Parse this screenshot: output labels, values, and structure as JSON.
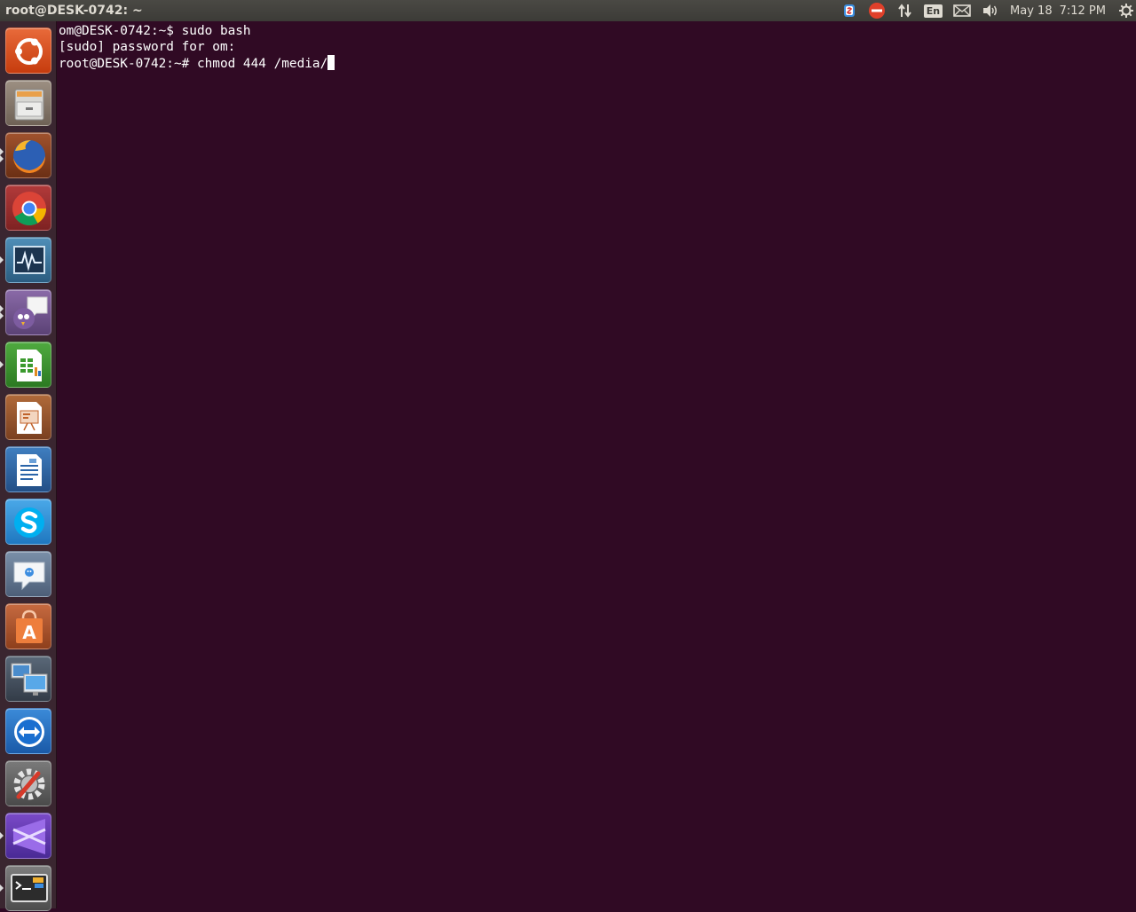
{
  "top_panel": {
    "window_title": "root@DESK-0742: ~",
    "indicators": {
      "keyboard_layout": "En",
      "date": "May 18",
      "time": "7:12 PM",
      "icons": [
        "skype-status-icon",
        "do-not-disturb-icon",
        "network-updown-icon",
        "keyboard-layout-icon",
        "mail-icon",
        "volume-icon",
        "session-gear-icon"
      ]
    }
  },
  "launcher": {
    "items": [
      {
        "name": "dash-home",
        "icon": "ubuntu-logo-icon",
        "running": false
      },
      {
        "name": "files",
        "icon": "file-cabinet-icon",
        "running": false
      },
      {
        "name": "firefox",
        "icon": "firefox-icon",
        "running": true
      },
      {
        "name": "chrome",
        "icon": "chrome-icon",
        "running": false
      },
      {
        "name": "system-monitor",
        "icon": "system-monitor-icon",
        "running": true
      },
      {
        "name": "pidgin",
        "icon": "pidgin-icon",
        "running": true
      },
      {
        "name": "libreoffice-calc",
        "icon": "spreadsheet-icon",
        "running": true
      },
      {
        "name": "libreoffice-impress",
        "icon": "presentation-icon",
        "running": false
      },
      {
        "name": "libreoffice-writer",
        "icon": "document-icon",
        "running": false
      },
      {
        "name": "skype",
        "icon": "skype-icon",
        "running": false
      },
      {
        "name": "empathy",
        "icon": "chat-bubble-icon",
        "running": false
      },
      {
        "name": "software-center",
        "icon": "shopping-bag-icon",
        "running": false
      },
      {
        "name": "remote-desktop",
        "icon": "remote-desktop-icon",
        "running": false
      },
      {
        "name": "teamviewer",
        "icon": "teamviewer-icon",
        "running": false
      },
      {
        "name": "system-settings",
        "icon": "wrench-gear-icon",
        "running": false
      },
      {
        "name": "visual-studio",
        "icon": "visual-studio-icon",
        "running": true
      },
      {
        "name": "terminal",
        "icon": "terminal-icon",
        "running": true
      }
    ]
  },
  "terminal": {
    "lines": [
      "om@DESK-0742:~$ sudo bash",
      "[sudo] password for om:",
      "root@DESK-0742:~# chmod 444 /media/"
    ]
  },
  "colors": {
    "terminal_bg": "#300a24",
    "terminal_fg": "#ffffff",
    "panel_bg": "#3c3b37",
    "launcher_bg": "#3a2630",
    "ubuntu_orange": "#dd4814"
  }
}
